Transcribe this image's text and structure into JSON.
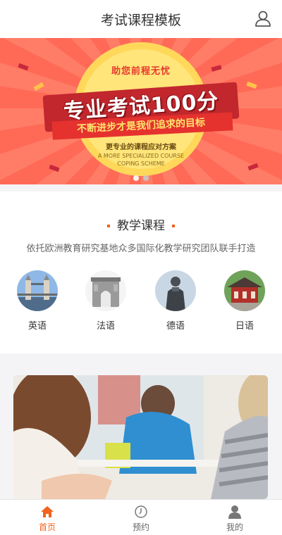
{
  "header": {
    "title": "考试课程模板",
    "user_icon": "user-icon"
  },
  "banner": {
    "tag": "助您前程无忧",
    "headline": "专业考试100分",
    "subline": "不断进步才是我们追求的目标",
    "small_cn": "更专业的课程应对方案",
    "small_en_1": "A MORE SPECIALIZED COURSE",
    "small_en_2": "COPING SCHEME",
    "active_slide": 1,
    "slide_count": 2,
    "colors": {
      "background": "#ff6a57",
      "ribbon": "#c1272d",
      "sun": "#ffe57a"
    }
  },
  "courses": {
    "title": "教学课程",
    "description": "依托欧洲教育研究基地众多国际化教学研究团队联手打造",
    "items": [
      {
        "label": "英语",
        "icon": "tower-bridge-image"
      },
      {
        "label": "法语",
        "icon": "arc-de-triomphe-image"
      },
      {
        "label": "德语",
        "icon": "statue-image"
      },
      {
        "label": "日语",
        "icon": "japanese-temple-image"
      }
    ]
  },
  "photo": {
    "icon": "students-classroom-image"
  },
  "tabbar": {
    "accent": "#f0641e",
    "items": [
      {
        "label": "首页",
        "icon": "home-icon",
        "active": true
      },
      {
        "label": "预约",
        "icon": "clock-icon",
        "active": false
      },
      {
        "label": "我的",
        "icon": "profile-icon",
        "active": false
      }
    ]
  }
}
